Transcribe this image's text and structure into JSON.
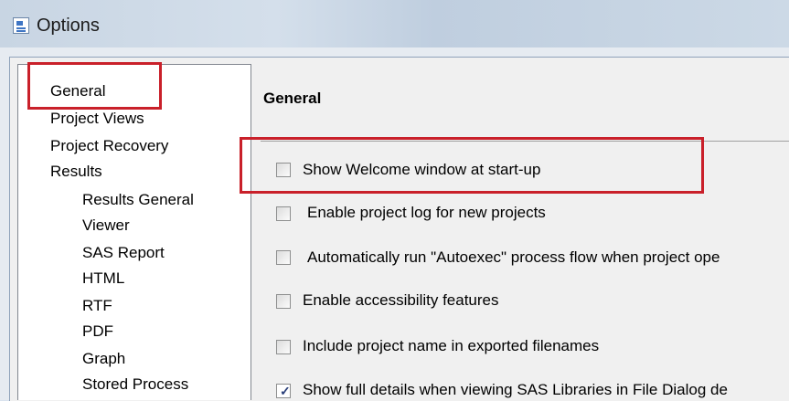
{
  "window": {
    "title": "Options"
  },
  "tree": {
    "items": [
      {
        "label": "General",
        "indent": 0
      },
      {
        "label": "Project Views",
        "indent": 0
      },
      {
        "label": "Project Recovery",
        "indent": 0
      },
      {
        "label": "Results",
        "indent": 0
      },
      {
        "label": "Results General",
        "indent": 1
      },
      {
        "label": "Viewer",
        "indent": 1
      },
      {
        "label": "SAS Report",
        "indent": 1
      },
      {
        "label": "HTML",
        "indent": 1
      },
      {
        "label": "RTF",
        "indent": 1
      },
      {
        "label": "PDF",
        "indent": 1
      },
      {
        "label": "Graph",
        "indent": 1
      },
      {
        "label": "Stored Process",
        "indent": 1
      }
    ]
  },
  "panel": {
    "title": "General",
    "options": [
      {
        "label": "Show Welcome window at start-up",
        "checked": false
      },
      {
        "label": "Enable project log for new projects",
        "checked": false
      },
      {
        "label": "Automatically run \"Autoexec\" process flow when project ope",
        "checked": false
      },
      {
        "label": "Enable accessibility features",
        "checked": false
      },
      {
        "label": "Include project name in exported filenames",
        "checked": false
      },
      {
        "label": "Show full details when viewing SAS Libraries in File Dialog de",
        "checked": true
      }
    ]
  },
  "colors": {
    "highlight": "#c9202a"
  }
}
